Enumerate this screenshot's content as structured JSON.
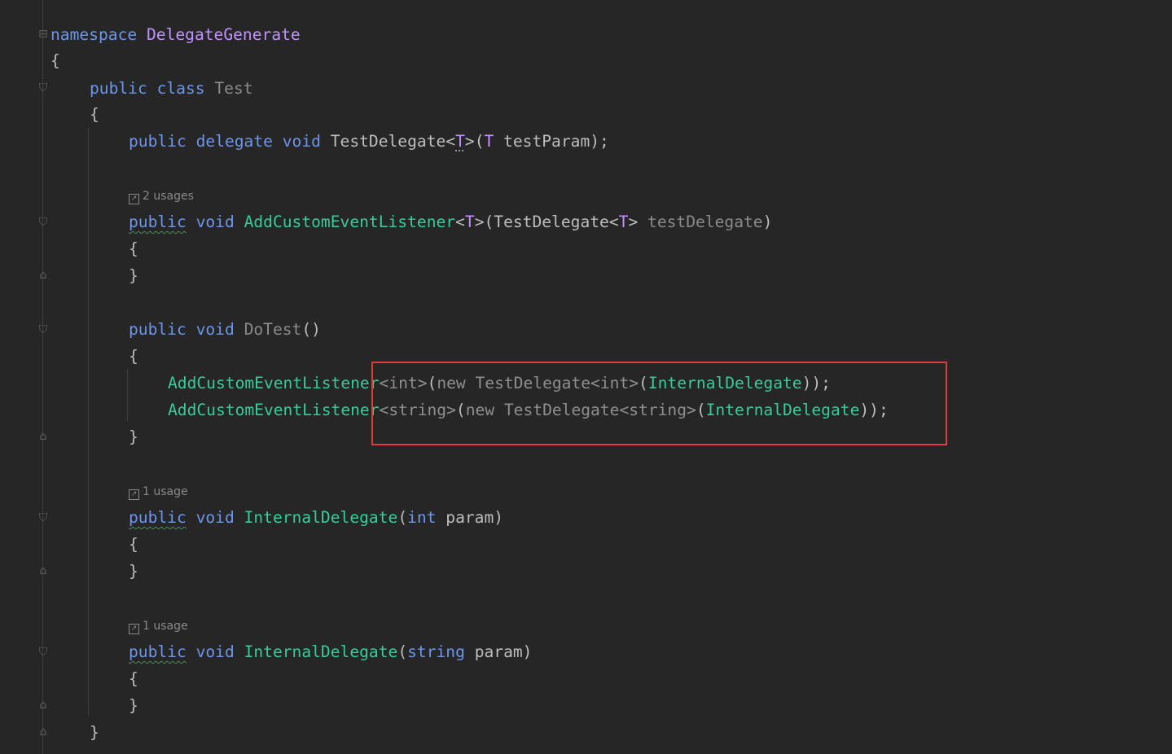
{
  "colors": {
    "background": "#262626",
    "keyword": "#6c95eb",
    "type": "#c191ff",
    "method": "#39cc9b",
    "highlight": "#e0393e"
  },
  "icons": {
    "fold": "fold-marker-icon",
    "usage": "usage-link-icon"
  },
  "code": {
    "l1": {
      "kw": "namespace",
      "name": "DelegateGenerate"
    },
    "l2": {
      "brace": "{"
    },
    "l3": {
      "kw1": "public",
      "kw2": "class",
      "name": "Test"
    },
    "l4": {
      "brace": "{"
    },
    "l5": {
      "kw1": "public",
      "kw2": "delegate",
      "kw3": "void",
      "name": "TestDelegate",
      "lt": "<",
      "tparam": "T",
      "gt": ">",
      "open": "(",
      "ptype": "T",
      "pname": "testParam",
      "close": ");"
    },
    "hint1": "2 usages",
    "l6": {
      "kw1": "public",
      "kw2": "void",
      "name": "AddCustomEventListener",
      "lt": "<",
      "tparam": "T",
      "gt": ">",
      "open": "(",
      "ptype": "TestDelegate",
      "plt": "<",
      "ptparam": "T",
      "pgt": ">",
      "pname": "testDelegate",
      "close": ")"
    },
    "l7": {
      "brace": "{"
    },
    "l8": {
      "brace": "}"
    },
    "l9": {
      "kw1": "public",
      "kw2": "void",
      "name": "DoTest",
      "parens": "()"
    },
    "l10": {
      "brace": "{"
    },
    "l11": {
      "method": "AddCustomEventListener",
      "targ": "<int>",
      "open": "(",
      "kwnew": "new",
      "type": "TestDelegate<int>",
      "open2": "(",
      "arg": "InternalDelegate",
      "close": "));"
    },
    "l12": {
      "method": "AddCustomEventListener",
      "targ": "<string>",
      "open": "(",
      "kwnew": "new",
      "type": "TestDelegate<string>",
      "open2": "(",
      "arg": "InternalDelegate",
      "close": "));"
    },
    "l13": {
      "brace": "}"
    },
    "hint2": "1 usage",
    "l14": {
      "kw1": "public",
      "kw2": "void",
      "name": "InternalDelegate",
      "open": "(",
      "ptype": "int",
      "pname": "param",
      "close": ")"
    },
    "l15": {
      "brace": "{"
    },
    "l16": {
      "brace": "}"
    },
    "hint3": "1 usage",
    "l17": {
      "kw1": "public",
      "kw2": "void",
      "name": "InternalDelegate",
      "open": "(",
      "ptype": "string",
      "pname": "param",
      "close": ")"
    },
    "l18": {
      "brace": "{"
    },
    "l19": {
      "brace": "}"
    },
    "l20": {
      "brace": "}"
    }
  }
}
